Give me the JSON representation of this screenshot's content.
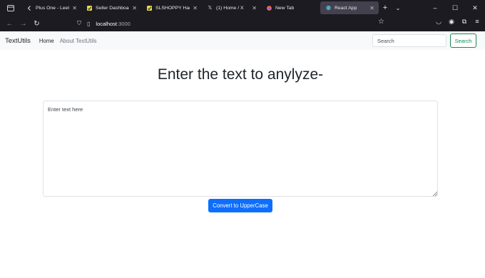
{
  "browser": {
    "tabs": [
      {
        "title": "Plus One - LeetCode",
        "favicon": "leetcode-icon",
        "active": false
      },
      {
        "title": "Seller Dashboard",
        "favicon": "seller-icon",
        "active": false
      },
      {
        "title": "SLSHOPPY Handicra",
        "favicon": "shop-icon",
        "active": false
      },
      {
        "title": "(1) Home / X",
        "favicon": "x-logo-icon",
        "active": false
      },
      {
        "title": "New Tab",
        "favicon": "firefox-icon",
        "active": false
      },
      {
        "title": "React App",
        "favicon": "react-icon",
        "active": true
      }
    ],
    "url_host": "localhost",
    "url_port": ":3000"
  },
  "navbar": {
    "brand": "TextUtils",
    "links": [
      "Home",
      "About TextUtils"
    ],
    "search_placeholder": "Search",
    "search_button": "Search"
  },
  "main": {
    "heading": "Enter the text to anylyze-",
    "textarea_placeholder": "Enter text here",
    "convert_button": "Convert to UpperCase"
  },
  "colors": {
    "chrome_bg": "#1c1b22",
    "active_tab_bg": "#42414d",
    "primary": "#0d6efd",
    "success": "#198754",
    "navbar_bg": "#f8f9fa"
  }
}
